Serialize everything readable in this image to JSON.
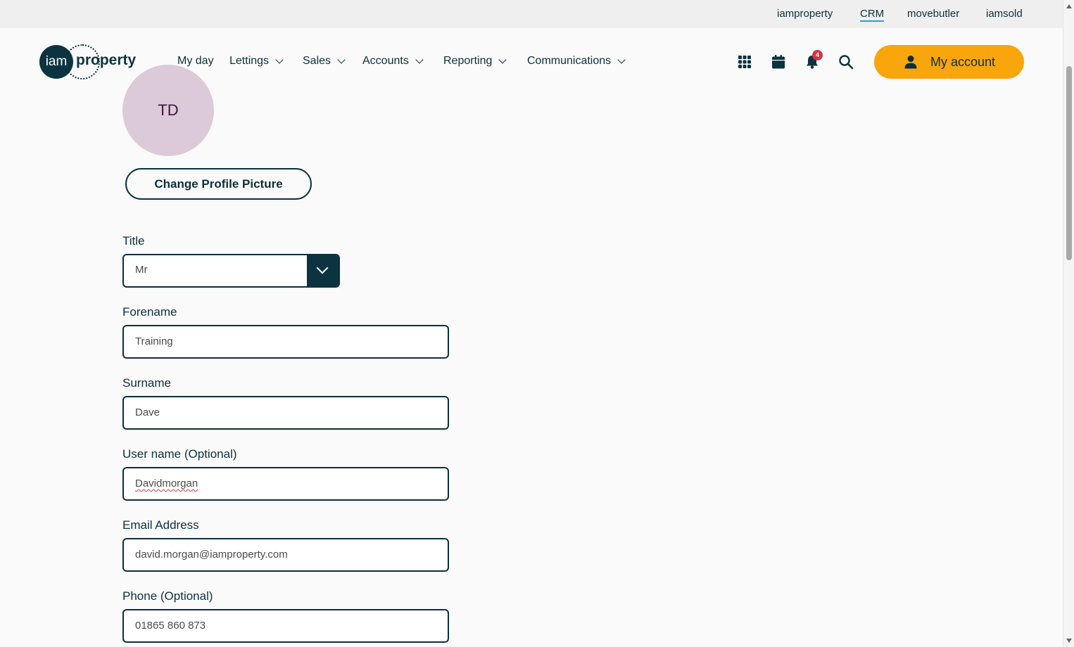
{
  "top_links": [
    "iamproperty",
    "CRM",
    "movebutler",
    "iamsold"
  ],
  "top_links_active": "CRM",
  "logo": {
    "circle_text": "iam",
    "word": "property"
  },
  "nav": [
    {
      "label": "My day"
    },
    {
      "label": "Lettings"
    },
    {
      "label": "Sales"
    },
    {
      "label": "Accounts"
    },
    {
      "label": "Reporting"
    },
    {
      "label": "Communications"
    }
  ],
  "header_icons": [
    "apps-grid-icon",
    "calendar-icon",
    "bell-icon",
    "search-icon"
  ],
  "notification_count": "4",
  "account_button": {
    "label": "My account",
    "icon": "user-icon"
  },
  "profile": {
    "initials": "TD",
    "change_picture_label": "Change Profile Picture"
  },
  "form": {
    "title": {
      "label": "Title",
      "value": "Mr"
    },
    "forename": {
      "label": "Forename",
      "value": "Training"
    },
    "surname": {
      "label": "Surname",
      "value": "Dave"
    },
    "username": {
      "label": "User name (Optional)",
      "value": "Davidmorgan"
    },
    "email": {
      "label": "Email Address",
      "value": "david.morgan@iamproperty.com"
    },
    "phone": {
      "label": "Phone (Optional)",
      "value": "01865 860 873"
    }
  },
  "colors": {
    "primary_dark": "#0c3440",
    "accent": "#f9a50c",
    "badge": "#d6333f",
    "avatar_bg": "#dccad8",
    "active_link_underline": "#2a9fd6"
  }
}
